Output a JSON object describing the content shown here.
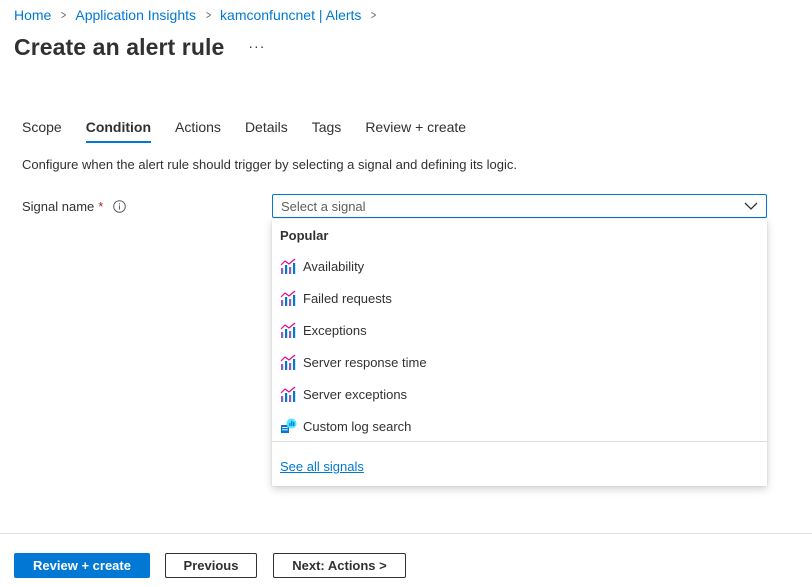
{
  "breadcrumb": {
    "items": [
      "Home",
      "Application Insights",
      "kamconfuncnet | Alerts"
    ]
  },
  "header": {
    "title": "Create an alert rule",
    "more": "···"
  },
  "tabs": [
    {
      "label": "Scope"
    },
    {
      "label": "Condition",
      "active": true
    },
    {
      "label": "Actions"
    },
    {
      "label": "Details"
    },
    {
      "label": "Tags"
    },
    {
      "label": "Review + create"
    }
  ],
  "condition": {
    "description": "Configure when the alert rule should trigger by selecting a signal and defining its logic.",
    "signal_label": "Signal name",
    "required_mark": "*",
    "select_placeholder": "Select a signal"
  },
  "dropdown": {
    "group_header": "Popular",
    "items": [
      {
        "label": "Availability",
        "icon": "metric-chart-icon"
      },
      {
        "label": "Failed requests",
        "icon": "metric-chart-icon"
      },
      {
        "label": "Exceptions",
        "icon": "metric-chart-icon"
      },
      {
        "label": "Server response time",
        "icon": "metric-chart-icon"
      },
      {
        "label": "Server exceptions",
        "icon": "metric-chart-icon"
      },
      {
        "label": "Custom log search",
        "icon": "log-search-icon"
      }
    ],
    "see_all": "See all signals"
  },
  "footer": {
    "review_create": "Review + create",
    "previous": "Previous",
    "next": "Next: Actions >"
  },
  "colors": {
    "accent": "#0078d4",
    "text": "#323130",
    "required": "#a4262c"
  }
}
